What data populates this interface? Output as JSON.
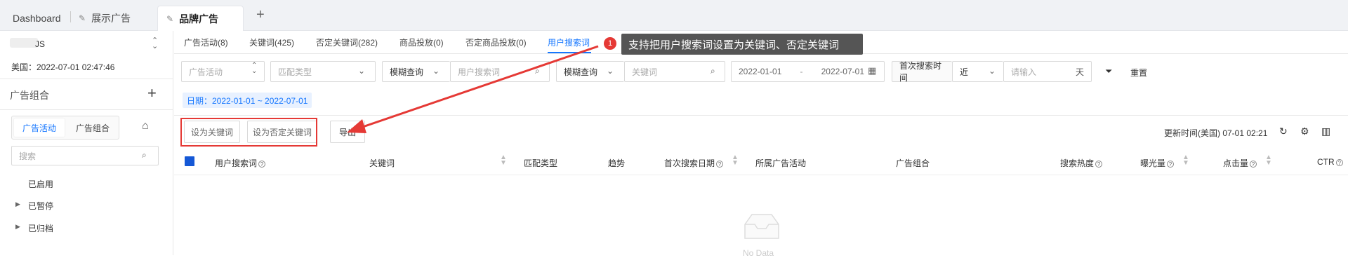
{
  "top_tabs": [
    {
      "label": "Dashboard"
    },
    {
      "label": "展示广告"
    },
    {
      "label": "品牌广告"
    }
  ],
  "add_tab_icon": "plus-icon",
  "sidebar": {
    "account_name": "JS",
    "account_time": "美国：2022-07-01 02:47:46",
    "section_title": "广告组合",
    "seg_tabs": [
      "广告活动",
      "广告组合"
    ],
    "search_placeholder": "搜索",
    "tree": [
      "已启用",
      "已暂停",
      "已归档"
    ]
  },
  "sub_tabs": [
    {
      "label": "广告活动(8)"
    },
    {
      "label": "关键词(425)"
    },
    {
      "label": "否定关键词(282)"
    },
    {
      "label": "商品投放(0)"
    },
    {
      "label": "否定商品投放(0)"
    },
    {
      "label": "用户搜索词"
    }
  ],
  "annotation": {
    "badge": "1",
    "text": "支持把用户搜索词设置为关键词、否定关键词"
  },
  "filters": {
    "campaign_placeholder": "广告活动",
    "match_type_placeholder": "匹配类型",
    "fuzzy1_value": "模糊查询",
    "search_term_placeholder": "用户搜索词",
    "fuzzy2_value": "模糊查询",
    "keyword_placeholder": "关键词",
    "date_start": "2022-01-01",
    "date_sep": "-",
    "date_end": "2022-07-01",
    "first_search_label": "首次搜索时间",
    "near_value": "近",
    "days_placeholder": "请输入",
    "days_unit": "天",
    "reset_label": "重置"
  },
  "date_tag": "日期：2022-01-01 ~ 2022-07-01",
  "actions": {
    "set_keyword": "设为关键词",
    "set_negative": "设为否定关键词",
    "export": "导出"
  },
  "update_time": "更新时间(美国) 07-01 02:21",
  "table_headers": [
    "用户搜索词",
    "关键词",
    "匹配类型",
    "趋势",
    "首次搜索日期",
    "所属广告活动",
    "广告组合",
    "搜索热度",
    "曝光量",
    "点击量",
    "CTR"
  ],
  "empty_text": "No Data",
  "colors": {
    "accent": "#1677ff",
    "highlight": "#e53935"
  }
}
